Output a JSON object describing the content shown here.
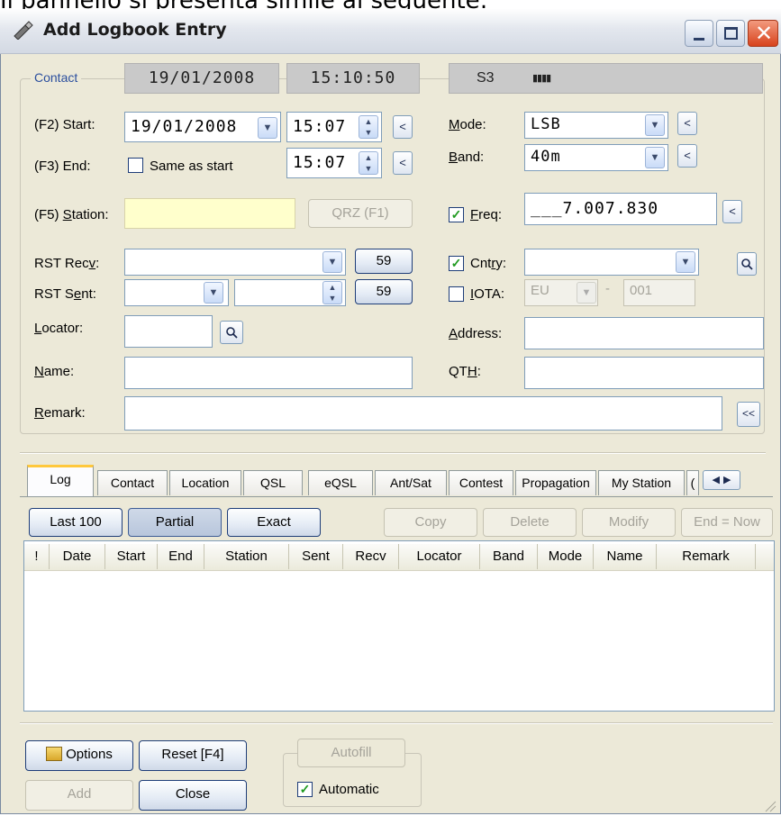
{
  "caption": "Il pannello si presenta simile al seguente:",
  "window": {
    "title": "Add Logbook Entry"
  },
  "contact": {
    "group_label": "Contact",
    "date": "19/01/2008",
    "time": "15:10:50",
    "signal": "S3",
    "signal_bars": "▮▮▮▮"
  },
  "start": {
    "label_prefix": "(F2) ",
    "label": "Start:",
    "date": "19/01/2008",
    "time": "15:07"
  },
  "end": {
    "label_prefix": "(F3) ",
    "label": "End:",
    "same_as_start": "Same as start",
    "time": "15:07"
  },
  "station": {
    "label_prefix": "(F5) ",
    "label": "Station:",
    "value": "",
    "qrz": "QRZ  (F1)"
  },
  "mode": {
    "label": "Mode:",
    "value": "LSB"
  },
  "band": {
    "label": "Band:",
    "value": "40m"
  },
  "freq": {
    "label": "Freq:",
    "value": "___7.007.830"
  },
  "rst_recv": {
    "label": "RST Recv:",
    "value": "",
    "btn": "59"
  },
  "rst_sent": {
    "label": "RST Sent:",
    "value": "",
    "btn": "59"
  },
  "cntry": {
    "label": "Cntry:",
    "value": ""
  },
  "iota": {
    "label": "IOTA:",
    "continent": "EU",
    "number": "001",
    "dash": "-"
  },
  "locator": {
    "label": "Locator:",
    "value": ""
  },
  "address": {
    "label": "Address:",
    "value": ""
  },
  "name": {
    "label": "Name:",
    "value": ""
  },
  "qth": {
    "label": "QTH:",
    "value": ""
  },
  "remark": {
    "label": "Remark:",
    "value": "",
    "btn": "<<"
  },
  "tabs": [
    "Log",
    "Contact",
    "Location",
    "QSL",
    "eQSL",
    "Ant/Sat",
    "Contest",
    "Propagation",
    "My Station",
    "("
  ],
  "filters": {
    "last100": "Last 100",
    "partial": "Partial",
    "exact": "Exact"
  },
  "actions": {
    "copy": "Copy",
    "delete": "Delete",
    "modify": "Modify",
    "end_now": "End = Now"
  },
  "columns": [
    "!",
    "Date",
    "Start",
    "End",
    "Station",
    "Sent",
    "Recv",
    "Locator",
    "Band",
    "Mode",
    "Name",
    "Remark"
  ],
  "bottom": {
    "options": "Options",
    "reset": "Reset  [F4]",
    "add": "Add",
    "close": "Close",
    "autofill": "Autofill",
    "automatic": "Automatic"
  },
  "colors": {
    "station_bg": "#ffffcc",
    "gray_box": "#c9c9c9",
    "active_tab_accent": "#ffc83c",
    "check_green": "#1f9a1f"
  }
}
